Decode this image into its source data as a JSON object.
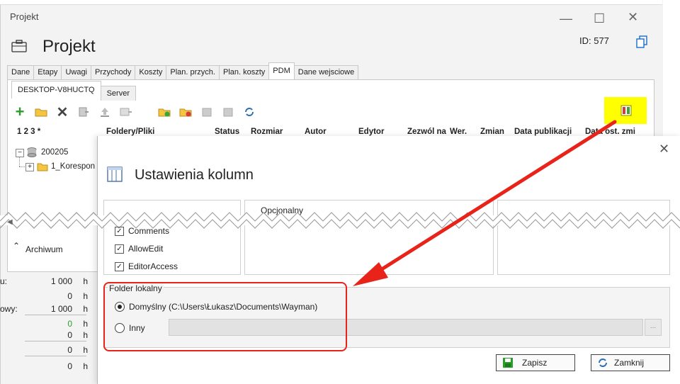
{
  "window": {
    "title": "Projekt",
    "heading": "Projekt",
    "id_label": "ID: 577",
    "tabs": [
      "Dane",
      "Etapy",
      "Uwagi",
      "Przychody",
      "Koszty",
      "Plan. przych.",
      "Plan. koszty",
      "PDM",
      "Dane wejsciowe"
    ],
    "active_tab": "PDM",
    "subtabs": [
      "DESKTOP-V8HUCTQ",
      "Server"
    ],
    "columns": [
      "1 2 3 *",
      "Foldery/Pliki",
      "Status",
      "Rozmiar",
      "Autor",
      "Edytor",
      "Zezwól na",
      "Wer.",
      "Zmian",
      "Data publikacji",
      "Data ost. zmi"
    ],
    "tree": [
      "200205",
      "1_Korespon"
    ],
    "archive_label": "Archiwum",
    "left_rows": [
      {
        "key": "u:",
        "value": "1 000",
        "unit": "h"
      },
      {
        "key": "",
        "value": "0",
        "unit": "h"
      },
      {
        "key": "owy:",
        "value": "1 000",
        "unit": "h"
      },
      {
        "key": "",
        "value": "0",
        "unit": "h"
      },
      {
        "key": "",
        "value": "0",
        "unit": "h"
      },
      {
        "key": "",
        "value": "0",
        "unit": "h"
      },
      {
        "key": "",
        "value": "0",
        "unit": "h"
      }
    ]
  },
  "dialog": {
    "title": "Ustawienia kolumn",
    "optional_label": "Opcjonalny",
    "checkboxes": [
      "Comments",
      "AllowEdit",
      "EditorAccess"
    ],
    "folder_group_label": "Folder lokalny",
    "radio_default": "Domyślny (C:\\Users\\Łukasz\\Documents\\Wayman)",
    "radio_other": "Inny",
    "browse_label": "...",
    "save_label": "Zapisz",
    "close_label": "Zamknij"
  },
  "colors": {
    "highlight": "#ffff00",
    "arrow": "#e8231a",
    "callout": "#e8231a"
  }
}
